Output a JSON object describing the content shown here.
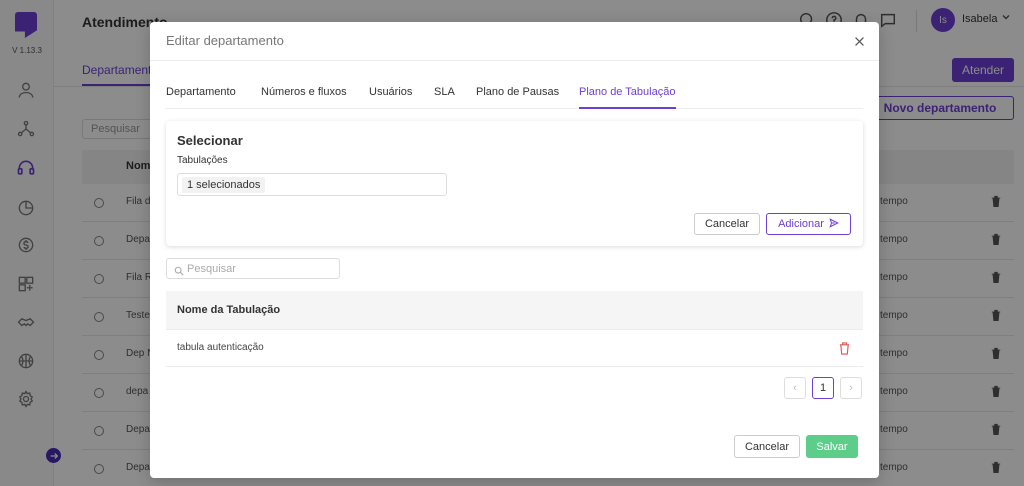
{
  "app": {
    "version": "V 1.13.3",
    "page_title": "Atendimento",
    "user": {
      "initials": "Is",
      "name": "Isabela"
    }
  },
  "background": {
    "tab_label": "Departamento",
    "atender_label": "Atender",
    "novo_departamento_label": "Novo departamento",
    "search_placeholder": "Pesquisar",
    "column_name": "Nome",
    "rows": [
      {
        "name": "Fila d",
        "tempo": "tempo"
      },
      {
        "name": "Depa",
        "tempo": "tempo"
      },
      {
        "name": "Fila R",
        "tempo": "tempo"
      },
      {
        "name": "Teste",
        "tempo": "tempo"
      },
      {
        "name": "Dep N",
        "tempo": "tempo"
      },
      {
        "name": "depa",
        "tempo": "tempo"
      },
      {
        "name": "Depa",
        "tempo": "tempo"
      },
      {
        "name": "Depa",
        "tempo": "tempo"
      }
    ]
  },
  "modal": {
    "title": "Editar departamento",
    "tabs": [
      {
        "label": "Departamento"
      },
      {
        "label": "Números e fluxos"
      },
      {
        "label": "Usuários"
      },
      {
        "label": "SLA"
      },
      {
        "label": "Plano de Pausas"
      },
      {
        "label": "Plano de Tabulação",
        "active": true
      }
    ],
    "select_card": {
      "title": "Selecionar",
      "field_label": "Tabulações",
      "selected_value": "1 selecionados",
      "cancel_label": "Cancelar",
      "add_label": "Adicionar"
    },
    "search_placeholder": "Pesquisar",
    "table": {
      "header": "Nome da Tabulação",
      "rows": [
        {
          "name": "tabula autenticação"
        }
      ]
    },
    "pagination": {
      "current_page": "1",
      "prev": "‹",
      "next": "›"
    },
    "cancel_label": "Cancelar",
    "save_label": "Salvar"
  },
  "colors": {
    "accent": "#6d3fd6",
    "save": "#5cce8a",
    "delete": "#e05050"
  }
}
